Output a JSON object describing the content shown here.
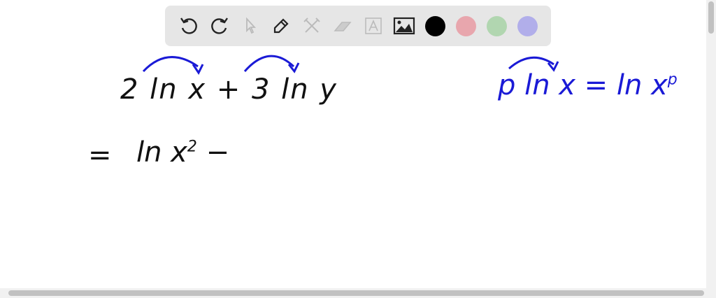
{
  "toolbar": {
    "tools": [
      "undo-icon",
      "redo-icon",
      "select-icon",
      "pen-icon",
      "tools-icon",
      "eraser-icon",
      "text-icon",
      "image-icon"
    ],
    "colors": [
      "#000000",
      "#e8a6ad",
      "#b1d6b0",
      "#b1aeea"
    ]
  },
  "canvas": {
    "line1": {
      "left": "2 ln x + 3 ln y"
    },
    "line2": {
      "eq": "=",
      "expr": "ln x",
      "exp": "2",
      "tail": " −"
    },
    "rule": {
      "left": "p ln x = ln x",
      "exp": "p"
    },
    "ink_colors": {
      "black": "#111111",
      "blue": "#1a1ad6"
    }
  }
}
